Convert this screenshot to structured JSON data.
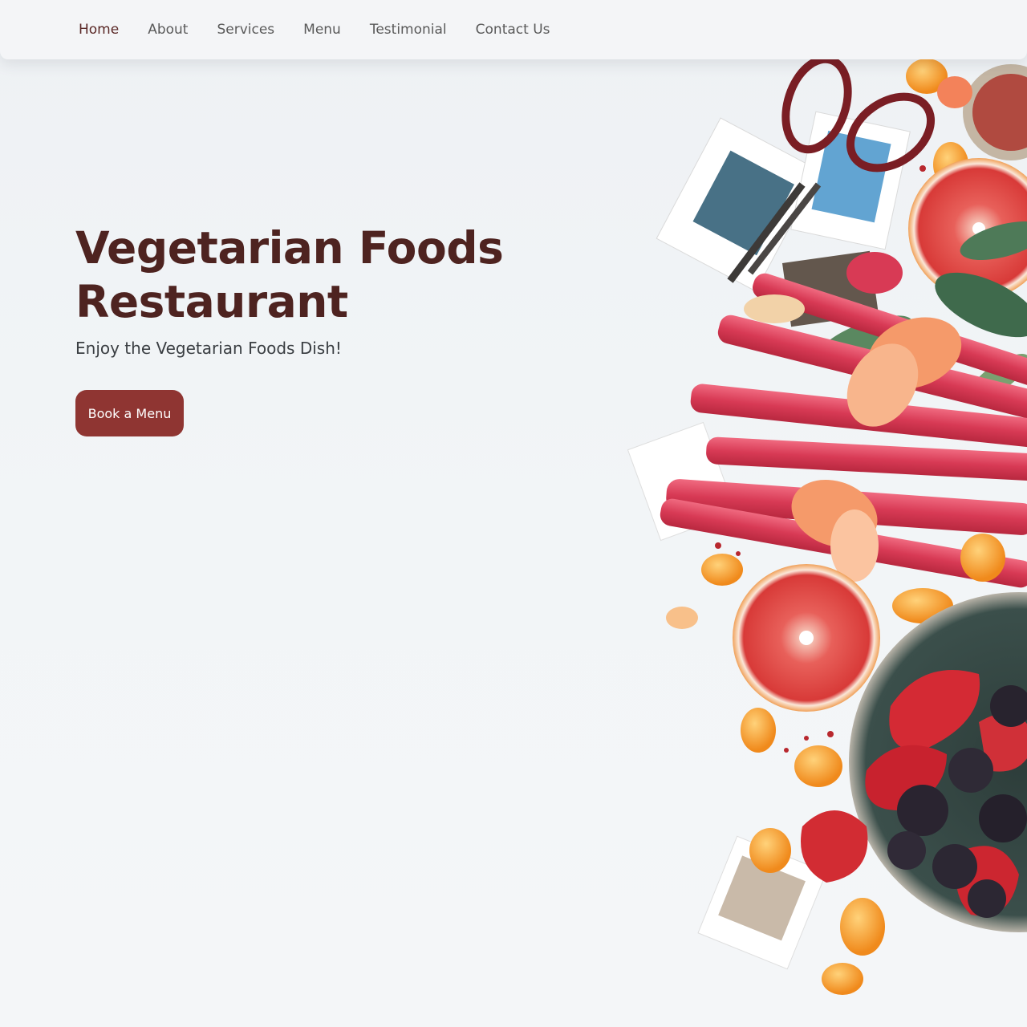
{
  "nav": {
    "items": [
      {
        "label": "Home",
        "active": true
      },
      {
        "label": "About",
        "active": false
      },
      {
        "label": "Services",
        "active": false
      },
      {
        "label": "Menu",
        "active": false
      },
      {
        "label": "Testimonial",
        "active": false
      },
      {
        "label": "Contact Us",
        "active": false
      }
    ]
  },
  "hero": {
    "title_line1": "Vegetarian Foods",
    "title_line2": "Restaurant",
    "subtitle": "Enjoy the Vegetarian Foods Dish!",
    "button_label": "Book a Menu"
  },
  "colors": {
    "brand_dark": "#4e2320",
    "button_bg": "#8f3532",
    "nav_active": "#5a2826",
    "nav_text": "#5a5a5a"
  }
}
